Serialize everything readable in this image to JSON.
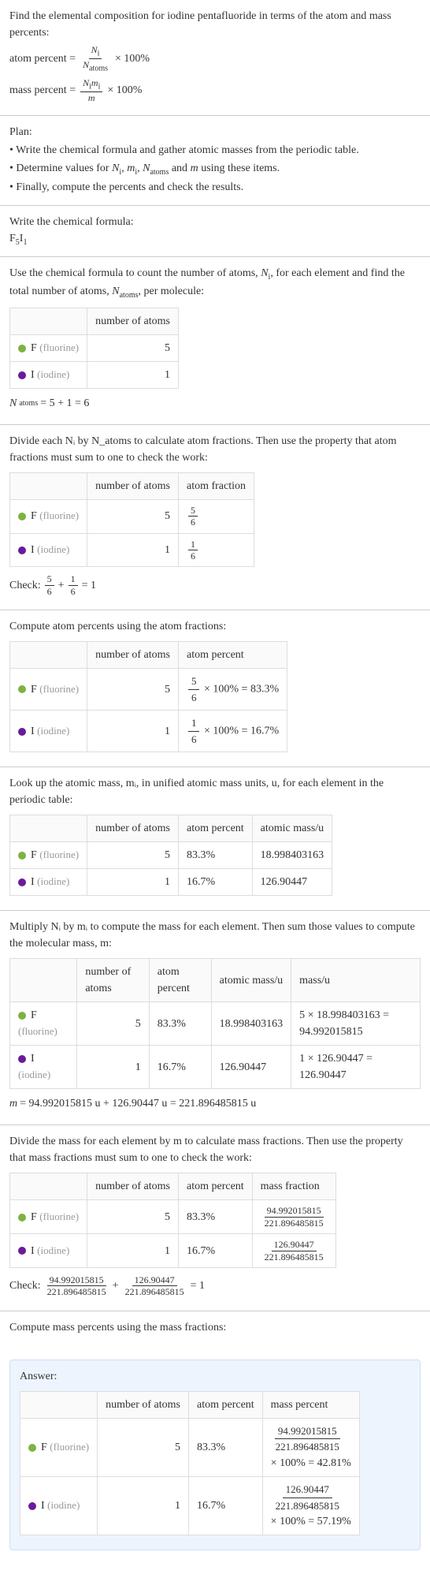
{
  "intro": {
    "text": "Find the elemental composition for iodine pentafluoride in terms of the atom and mass percents:",
    "atom_percent_label": "atom percent =",
    "mass_percent_label": "mass percent =",
    "times100": "× 100%",
    "Ni": "N",
    "i": "i",
    "Natoms": "N",
    "atoms": "atoms",
    "Nimi": "N",
    "mi": "m",
    "m": "m"
  },
  "plan": {
    "heading": "Plan:",
    "item1": "• Write the chemical formula and gather atomic masses from the periodic table.",
    "item2_a": "• Determine values for ",
    "item2_b": " using these items.",
    "vars": "Nᵢ, mᵢ, N_atoms and m",
    "item3": "• Finally, compute the percents and check the results."
  },
  "formula_section": {
    "heading": "Write the chemical formula:",
    "formula": "F₅I₁"
  },
  "count_section": {
    "text_a": "Use the chemical formula to count the number of atoms, ",
    "text_b": ", for each element and find the total number of atoms, ",
    "text_c": ", per molecule:",
    "Ni": "Nᵢ",
    "Natoms": "N_atoms",
    "col_num": "number of atoms",
    "f_label": "F ",
    "f_name": "(fluorine)",
    "f_count": "5",
    "i_label": "I ",
    "i_name": "(iodine)",
    "i_count": "1",
    "total_eq": "N_atoms = 5 + 1 = 6"
  },
  "atom_frac_section": {
    "text": "Divide each Nᵢ by N_atoms to calculate atom fractions. Then use the property that atom fractions must sum to one to check the work:",
    "col_num": "number of atoms",
    "col_frac": "atom fraction",
    "f_count": "5",
    "f_num": "5",
    "f_den": "6",
    "i_count": "1",
    "i_num": "1",
    "i_den": "6",
    "check_label": "Check: ",
    "plus": " + ",
    "eq1": " = 1"
  },
  "atom_pct_section": {
    "text": "Compute atom percents using the atom fractions:",
    "col_num": "number of atoms",
    "col_pct": "atom percent",
    "f_count": "5",
    "f_num": "5",
    "f_den": "6",
    "f_pct": " × 100% = 83.3%",
    "i_count": "1",
    "i_num": "1",
    "i_den": "6",
    "i_pct": " × 100% = 16.7%"
  },
  "atomic_mass_section": {
    "text": "Look up the atomic mass, mᵢ, in unified atomic mass units, u, for each element in the periodic table:",
    "col_num": "number of atoms",
    "col_pct": "atom percent",
    "col_mass": "atomic mass/u",
    "f_count": "5",
    "f_pct": "83.3%",
    "f_mass": "18.998403163",
    "i_count": "1",
    "i_pct": "16.7%",
    "i_mass": "126.90447"
  },
  "molec_mass_section": {
    "text": "Multiply Nᵢ by mᵢ to compute the mass for each element. Then sum those values to compute the molecular mass, m:",
    "col_num": "number of atoms",
    "col_pct": "atom percent",
    "col_amass": "atomic mass/u",
    "col_mass": "mass/u",
    "f_count": "5",
    "f_pct": "83.3%",
    "f_amass": "18.998403163",
    "f_mass": "5 × 18.998403163 = 94.992015815",
    "i_count": "1",
    "i_pct": "16.7%",
    "i_amass": "126.90447",
    "i_mass": "1 × 126.90447 = 126.90447",
    "total": "m = 94.992015815 u + 126.90447 u = 221.896485815 u"
  },
  "mass_frac_section": {
    "text": "Divide the mass for each element by m to calculate mass fractions. Then use the property that mass fractions must sum to one to check the work:",
    "col_num": "number of atoms",
    "col_pct": "atom percent",
    "col_mfrac": "mass fraction",
    "f_count": "5",
    "f_pct": "83.3%",
    "f_num": "94.992015815",
    "f_den": "221.896485815",
    "i_count": "1",
    "i_pct": "16.7%",
    "i_num": "126.90447",
    "i_den": "221.896485815",
    "check_label": "Check: ",
    "plus": " + ",
    "eq1": " = 1"
  },
  "mass_pct_section": {
    "text": "Compute mass percents using the mass fractions:"
  },
  "answer": {
    "heading": "Answer:",
    "col_num": "number of atoms",
    "col_pct": "atom percent",
    "col_mpct": "mass percent",
    "f_count": "5",
    "f_pct": "83.3%",
    "f_num": "94.992015815",
    "f_den": "221.896485815",
    "f_res": "× 100% = 42.81%",
    "i_count": "1",
    "i_pct": "16.7%",
    "i_num": "126.90447",
    "i_den": "221.896485815",
    "i_res": "× 100% = 57.19%"
  },
  "elements": {
    "f_label": "F ",
    "f_name": "(fluorine)",
    "i_label": "I ",
    "i_name": "(iodine)"
  },
  "chart_data": {
    "type": "table",
    "elements": [
      {
        "symbol": "F",
        "name": "fluorine",
        "atoms": 5,
        "atom_fraction": "5/6",
        "atom_percent": 83.3,
        "atomic_mass_u": 18.998403163,
        "mass_u": 94.992015815,
        "mass_fraction": "94.992015815/221.896485815",
        "mass_percent": 42.81
      },
      {
        "symbol": "I",
        "name": "iodine",
        "atoms": 1,
        "atom_fraction": "1/6",
        "atom_percent": 16.7,
        "atomic_mass_u": 126.90447,
        "mass_u": 126.90447,
        "mass_fraction": "126.90447/221.896485815",
        "mass_percent": 57.19
      }
    ],
    "N_atoms": 6,
    "molecular_mass_u": 221.896485815
  }
}
